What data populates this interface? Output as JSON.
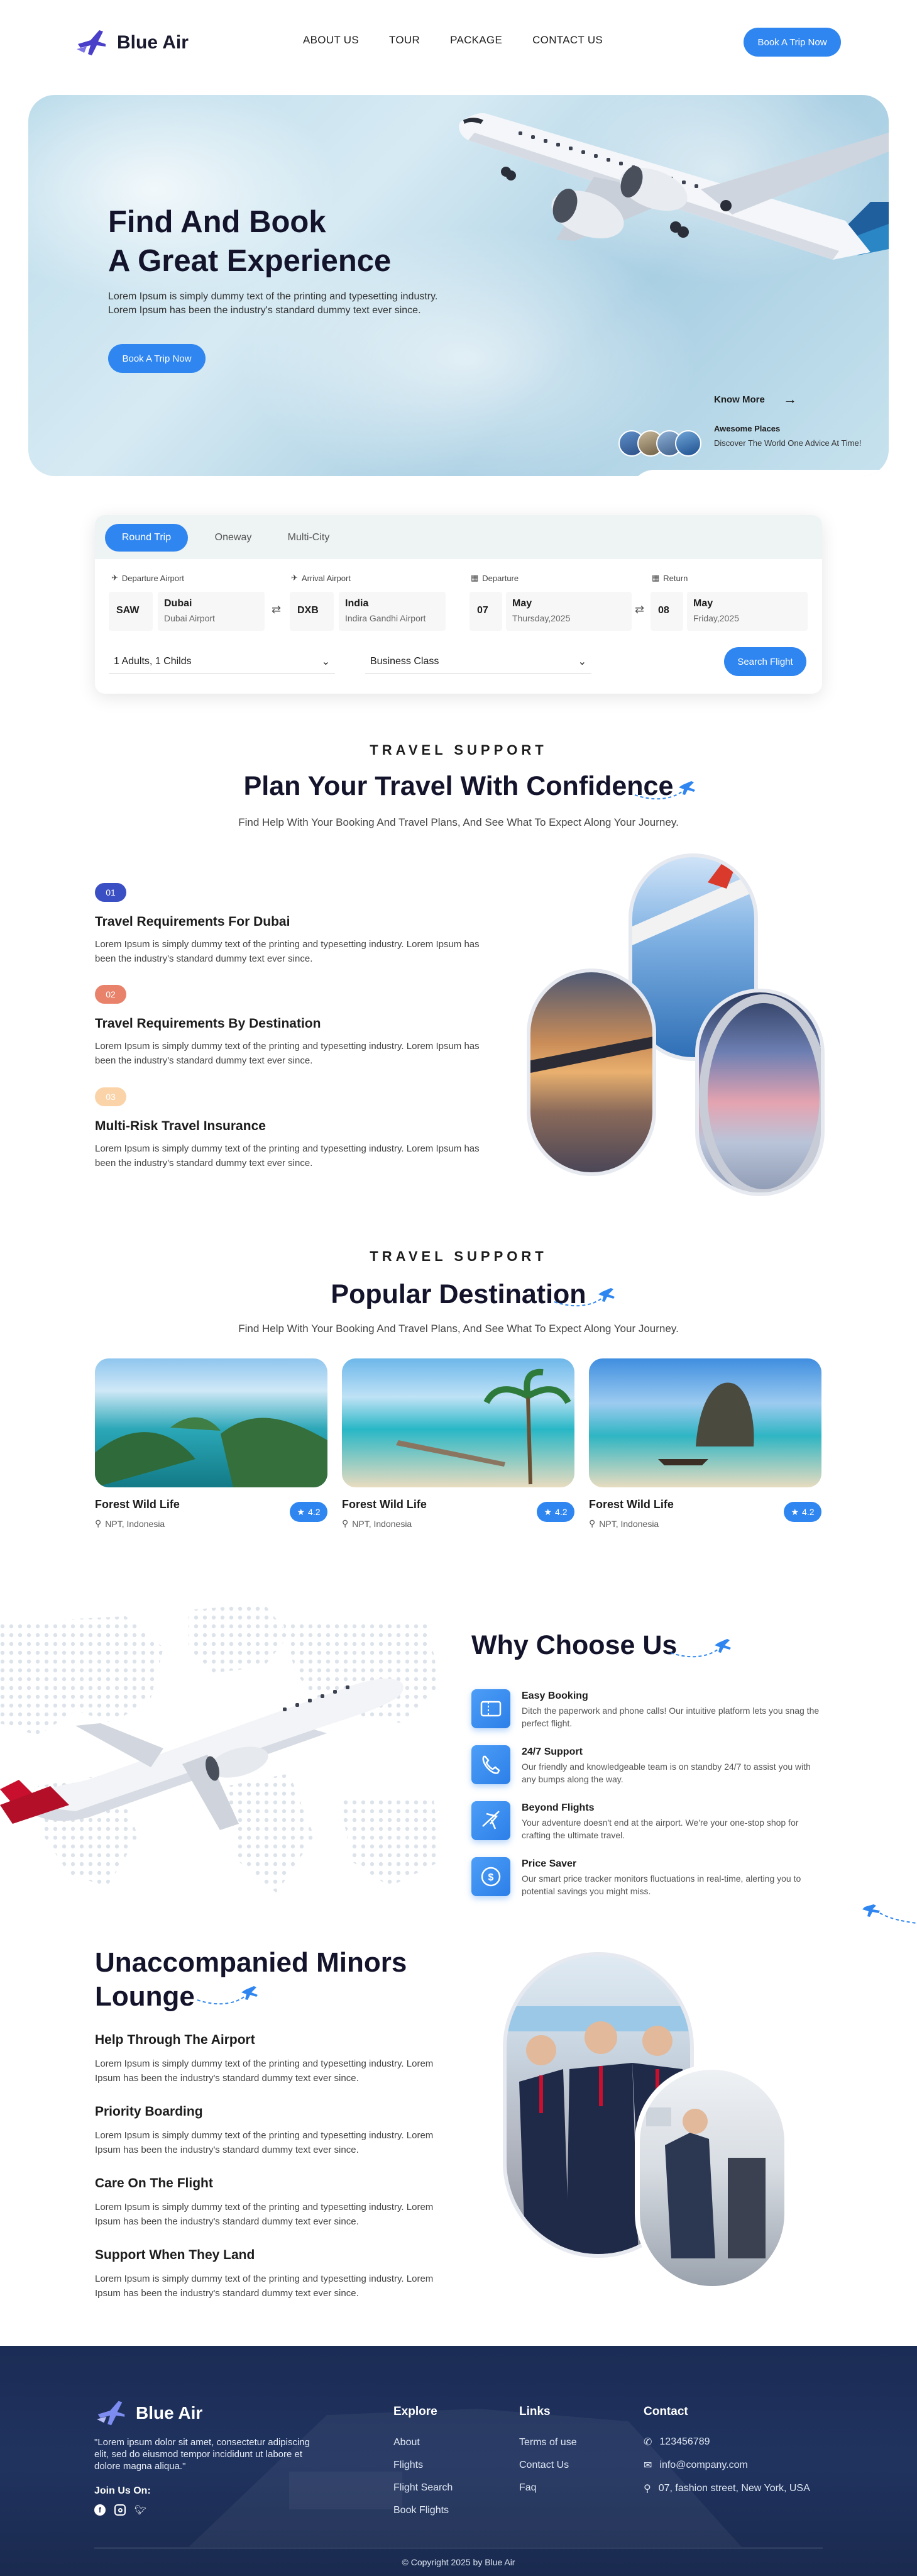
{
  "brand": {
    "name": "Blue Air",
    "accent": "#2f86f0",
    "dark": "#13132b"
  },
  "nav": {
    "items": [
      "ABOUT US",
      "TOUR",
      "PACKAGE",
      "CONTACT US"
    ],
    "cta": "Book A Trip Now"
  },
  "hero": {
    "title_line1": "Find And Book",
    "title_line2": "A Great Experience",
    "description": "Lorem Ipsum is simply dummy text of the printing and typesetting industry. Lorem Ipsum has been the industry's standard dummy text ever since.",
    "cta": "Book A Trip Now",
    "know_more": "Know More",
    "card_title": "Awesome Places",
    "card_desc": "Discover The World One Advice At Time!"
  },
  "search": {
    "tabs": [
      "Round Trip",
      "Oneway",
      "Multi-City"
    ],
    "active_tab": "Round Trip",
    "departure_airport_label": "Departure Airport",
    "arrival_airport_label": "Arrival Airport",
    "departure_label": "Departure",
    "return_label": "Return",
    "from_code": "SAW",
    "from_city": "Dubai",
    "from_airport": "Dubai Airport",
    "to_code": "DXB",
    "to_city": "India",
    "to_airport": "Indira Gandhi Airport",
    "dep_day": "07",
    "dep_month": "May",
    "dep_date": "Thursday,2025",
    "ret_day": "08",
    "ret_month": "May",
    "ret_date": "Friday,2025",
    "passengers": "1 Adults, 1 Childs",
    "cabin": "Business Class",
    "button": "Search Flight"
  },
  "support": {
    "eyebrow": "TRAVEL SUPPORT",
    "title": "Plan Your Travel With Confidence",
    "subtitle": "Find Help With Your Booking And Travel Plans, And See What To Expect Along Your Journey.",
    "items": [
      {
        "num": "01",
        "color": "#3b4fc4",
        "title": "Travel Requirements For Dubai",
        "desc": "Lorem Ipsum is simply dummy text of the printing and typesetting industry. Lorem Ipsum has been the industry's standard dummy text ever since."
      },
      {
        "num": "02",
        "color": "#e9826a",
        "title": "Travel Requirements By Destination",
        "desc": "Lorem Ipsum is simply dummy text of the printing and typesetting industry. Lorem Ipsum has been the industry's standard dummy text ever since."
      },
      {
        "num": "03",
        "color": "#fbd3a8",
        "title": "Multi-Risk Travel Insurance",
        "desc": "Lorem Ipsum is simply dummy text of the printing and typesetting industry. Lorem Ipsum has been the industry's standard dummy text ever since."
      }
    ]
  },
  "destinations": {
    "eyebrow": "TRAVEL SUPPORT",
    "title": "Popular Destination",
    "subtitle": "Find Help With Your Booking And Travel Plans, And See What To Expect Along Your Journey.",
    "cards": [
      {
        "name": "Forest Wild Life",
        "rating": "4.2",
        "location": "NPT, Indonesia"
      },
      {
        "name": "Forest Wild Life",
        "rating": "4.2",
        "location": "NPT, Indonesia"
      },
      {
        "name": "Forest Wild Life",
        "rating": "4.2",
        "location": "NPT, Indonesia"
      }
    ]
  },
  "why": {
    "title": "Why Choose Us",
    "items": [
      {
        "title": "Easy Booking",
        "desc": "Ditch the paperwork and phone calls! Our intuitive platform lets you snag the perfect flight.",
        "icon": "ticket-icon"
      },
      {
        "title": "24/7 Support",
        "desc": "Our friendly and knowledgeable team is on standby 24/7 to assist you with any bumps along the way.",
        "icon": "phone-icon"
      },
      {
        "title": "Beyond Flights",
        "desc": "Your adventure doesn't end at the airport. We're your one-stop shop for crafting the ultimate travel.",
        "icon": "plane-icon"
      },
      {
        "title": "Price Saver",
        "desc": "Our smart price tracker monitors fluctuations in real-time, alerting you to potential savings you might miss.",
        "icon": "dollar-icon"
      }
    ]
  },
  "lounge": {
    "title_line1": "Unaccompanied Minors",
    "title_line2": "Lounge",
    "items": [
      {
        "title": "Help Through The Airport",
        "desc": "Lorem Ipsum is simply dummy text of the printing and typesetting industry. Lorem Ipsum has been the industry's standard dummy text ever since."
      },
      {
        "title": "Priority Boarding",
        "desc": "Lorem Ipsum is simply dummy text of the printing and typesetting industry. Lorem Ipsum has been the industry's standard dummy text ever since."
      },
      {
        "title": "Care On The Flight",
        "desc": "Lorem Ipsum is simply dummy text of the printing and typesetting industry. Lorem Ipsum has been the industry's standard dummy text ever since."
      },
      {
        "title": "Support When They Land",
        "desc": "Lorem Ipsum is simply dummy text of the printing and typesetting industry. Lorem Ipsum has been the industry's standard dummy text ever since."
      }
    ]
  },
  "footer": {
    "about": "\"Lorem ipsum dolor sit amet, consectetur adipiscing elit, sed do eiusmod tempor incididunt ut labore et dolore magna aliqua.\"",
    "follow": "Join Us On:",
    "explore_title": "Explore",
    "explore": [
      "About",
      "Flights",
      "Flight Search",
      "Book Flights"
    ],
    "links_title": "Links",
    "links": [
      "Terms of use",
      "Contact Us",
      "Faq"
    ],
    "contact_title": "Contact",
    "phone": "123456789",
    "email": "info@company.com",
    "address": "07, fashion street, New York, USA",
    "copyright": "© Copyright 2025 by Blue Air"
  }
}
